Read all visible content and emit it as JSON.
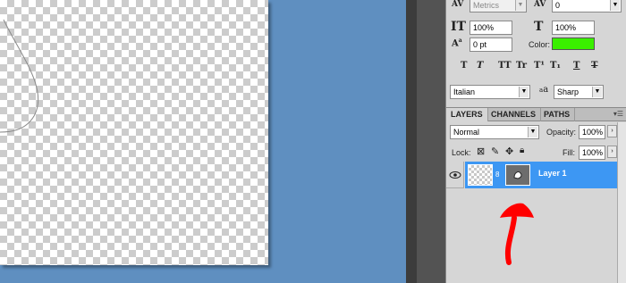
{
  "character": {
    "kerning_value": "Metrics",
    "tracking_value": "0",
    "vertical_scale": "100%",
    "horizontal_scale": "100%",
    "baseline_shift": "0 pt",
    "color_label": "Color:",
    "color_swatch": "#3af000",
    "language": "Italian",
    "aa_icon_text": "a",
    "antialias": "Sharp",
    "style_buttons": [
      "T",
      "T",
      "TT",
      "Tr",
      "T¹",
      "T₁",
      "T",
      "T"
    ]
  },
  "layers_panel": {
    "tabs": [
      "LAYERS",
      "CHANNELS",
      "PATHS"
    ],
    "active_tab": "LAYERS",
    "blend_mode": "Normal",
    "opacity_label": "Opacity:",
    "opacity_value": "100%",
    "lock_label": "Lock:",
    "fill_label": "Fill:",
    "fill_value": "100%",
    "layers": [
      {
        "name": "Layer 1",
        "selected": true,
        "visible": true
      }
    ]
  },
  "annotation": {
    "color": "#ff0000"
  },
  "icons": [
    "kerning-icon",
    "tracking-icon",
    "vertical-scale-icon",
    "horizontal-scale-icon",
    "baseline-shift-icon",
    "eye-icon",
    "lock-icon",
    "link-icon"
  ]
}
